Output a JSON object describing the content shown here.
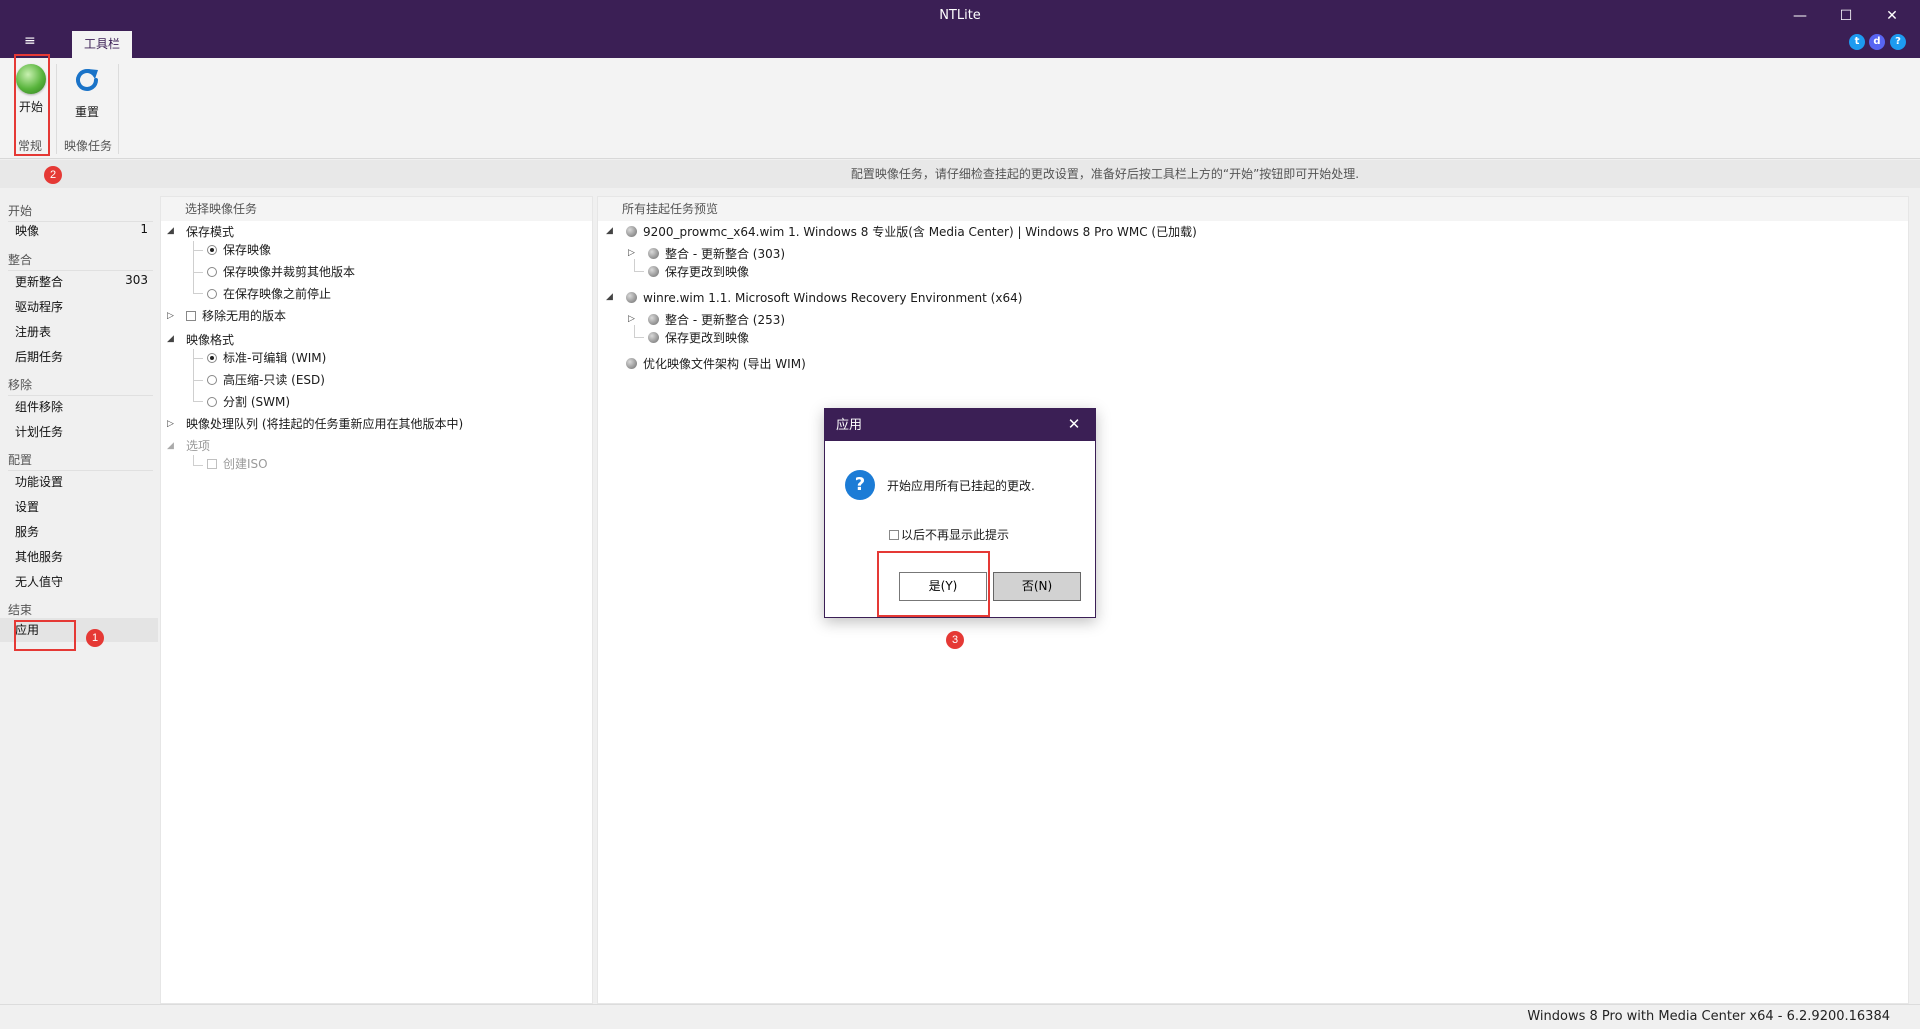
{
  "window": {
    "title": "NTLite",
    "minimize": "—",
    "maximize": "☐",
    "close": "✕"
  },
  "menu": {
    "hamburger": "≡",
    "tab_toolbar": "工具栏"
  },
  "social_icons": [
    "twitter-icon",
    "discord-icon",
    "help-icon"
  ],
  "ribbon": {
    "start_label": "开始",
    "reset_label": "重置",
    "group_general": "常规",
    "group_image_task": "映像任务"
  },
  "info_text": "配置映像任务，请仔细检查挂起的更改设置，准备好后按工具栏上方的“开始”按钮即可开始处理.",
  "sidebar": {
    "sections": [
      {
        "title": "开始",
        "items": [
          {
            "label": "映像",
            "count": "1"
          }
        ]
      },
      {
        "title": "整合",
        "items": [
          {
            "label": "更新整合",
            "count": "303"
          },
          {
            "label": "驱动程序"
          },
          {
            "label": "注册表"
          },
          {
            "label": "后期任务"
          }
        ]
      },
      {
        "title": "移除",
        "items": [
          {
            "label": "组件移除"
          },
          {
            "label": "计划任务"
          }
        ]
      },
      {
        "title": "配置",
        "items": [
          {
            "label": "功能设置"
          },
          {
            "label": "设置"
          },
          {
            "label": "服务"
          },
          {
            "label": "其他服务"
          },
          {
            "label": "无人值守"
          }
        ]
      },
      {
        "title": "结束",
        "items": [
          {
            "label": "应用"
          }
        ]
      }
    ]
  },
  "tasks_panel": {
    "header": "选择映像任务",
    "save_mode": "保存模式",
    "save_image": "保存映像",
    "save_trim": "保存映像并裁剪其他版本",
    "stop_before": "在保存映像之前停止",
    "remove_unused": "移除无用的版本",
    "format": "映像格式",
    "wim": "标准-可编辑 (WIM)",
    "esd": "高压缩-只读 (ESD)",
    "swm": "分割 (SWM)",
    "queue": "映像处理队列 (将挂起的任务重新应用在其他版本中)",
    "options": "选项",
    "create_iso": "创建ISO"
  },
  "preview_panel": {
    "header": "所有挂起任务预览",
    "image1": "9200_prowmc_x64.wim 1. Windows 8 专业版(含 Media Center)  |  Windows 8 Pro WMC  (已加载)",
    "image1_integrate": "整合 - 更新整合 (303)",
    "image1_save": "保存更改到映像",
    "image2": "winre.wim 1.1. Microsoft Windows Recovery Environment (x64)",
    "image2_integrate": "整合 - 更新整合 (253)",
    "image2_save": "保存更改到映像",
    "optimize": "优化映像文件架构 (导出 WIM)"
  },
  "dialog": {
    "title": "应用",
    "message": "开始应用所有已挂起的更改.",
    "dont_show": "以后不再显示此提示",
    "yes": "是(Y)",
    "no": "否(N)",
    "close": "✕",
    "question_mark": "?"
  },
  "status_bar": "Windows 8 Pro with Media Center x64 - 6.2.9200.16384",
  "annotations": [
    "1",
    "2",
    "3"
  ],
  "colors": {
    "accent": "#3b1f55",
    "highlight": "#e53935",
    "question": "#1c7cd6"
  }
}
